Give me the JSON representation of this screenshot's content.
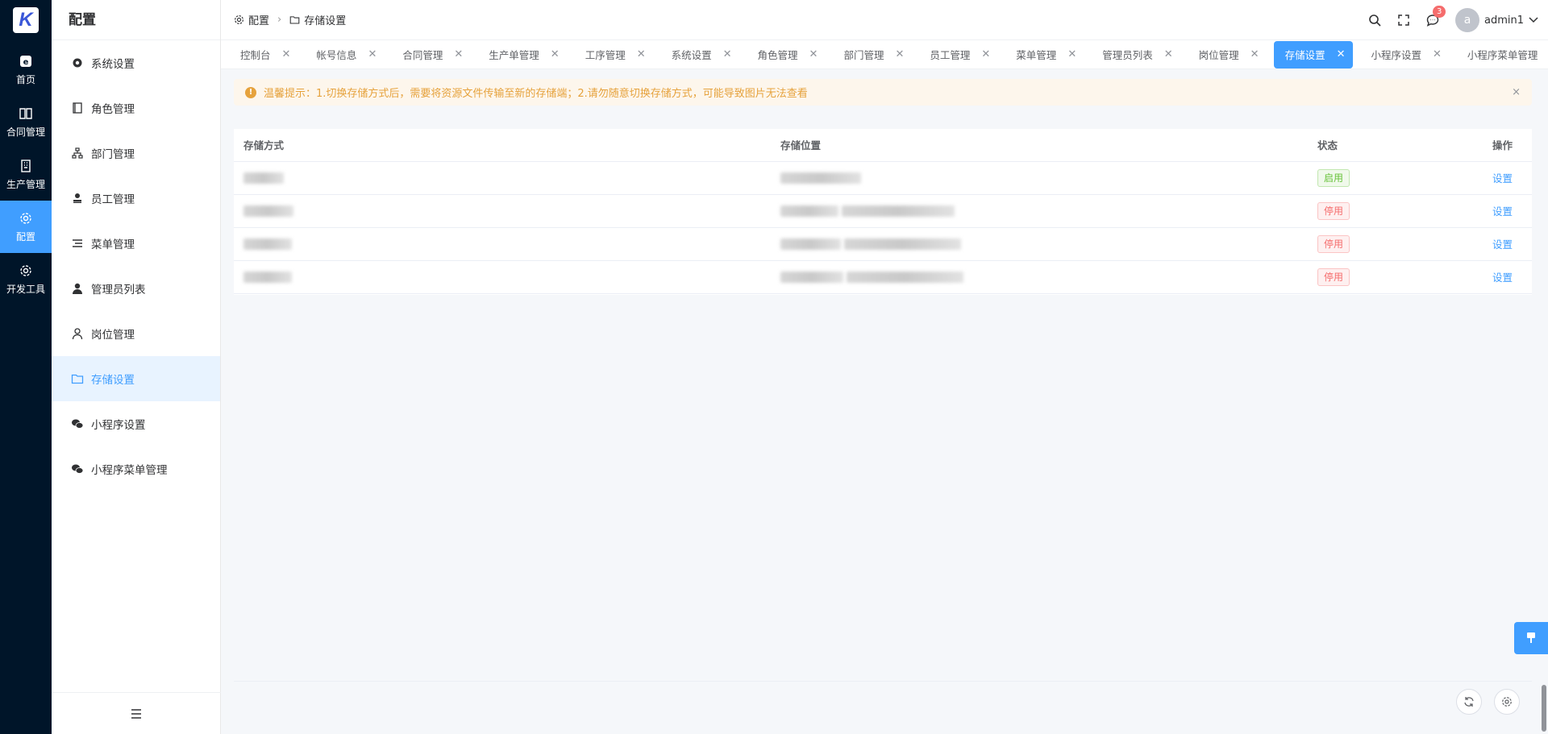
{
  "rail": {
    "logo_letter": "K",
    "items": [
      {
        "label": "首页",
        "icon": "home-icon"
      },
      {
        "label": "合同管理",
        "icon": "book-icon"
      },
      {
        "label": "生产管理",
        "icon": "building-icon"
      },
      {
        "label": "配置",
        "icon": "gear-icon",
        "active": true
      },
      {
        "label": "开发工具",
        "icon": "gear-icon"
      }
    ]
  },
  "sidebar": {
    "title": "配置",
    "items": [
      {
        "label": "系统设置",
        "icon": "gear-icon"
      },
      {
        "label": "角色管理",
        "icon": "notebook-icon"
      },
      {
        "label": "部门管理",
        "icon": "org-chart-icon"
      },
      {
        "label": "员工管理",
        "icon": "stamp-icon"
      },
      {
        "label": "菜单管理",
        "icon": "list-icon"
      },
      {
        "label": "管理员列表",
        "icon": "user-filled-icon"
      },
      {
        "label": "岗位管理",
        "icon": "user-outline-icon"
      },
      {
        "label": "存储设置",
        "icon": "folder-icon",
        "active": true
      },
      {
        "label": "小程序设置",
        "icon": "wechat-icon"
      },
      {
        "label": "小程序菜单管理",
        "icon": "wechat-icon"
      }
    ]
  },
  "header": {
    "breadcrumb": [
      "配置",
      "存储设置"
    ],
    "notification_count": "3",
    "avatar_letter": "a",
    "username": "admin1"
  },
  "tabs": [
    {
      "label": "控制台"
    },
    {
      "label": "帐号信息"
    },
    {
      "label": "合同管理"
    },
    {
      "label": "生产单管理"
    },
    {
      "label": "工序管理"
    },
    {
      "label": "系统设置"
    },
    {
      "label": "角色管理"
    },
    {
      "label": "部门管理"
    },
    {
      "label": "员工管理"
    },
    {
      "label": "菜单管理"
    },
    {
      "label": "管理员列表"
    },
    {
      "label": "岗位管理"
    },
    {
      "label": "存储设置",
      "active": true
    },
    {
      "label": "小程序设置"
    },
    {
      "label": "小程序菜单管理"
    }
  ],
  "alert": {
    "text": "温馨提示：1.切换存储方式后，需要将资源文件传输至新的存储端；2.请勿随意切换存储方式，可能导致图片无法查看",
    "close": "×"
  },
  "table": {
    "columns": [
      "存储方式",
      "存储位置",
      "状态",
      "操作"
    ],
    "rows": [
      {
        "status": "启用",
        "status_type": "on",
        "action": "设置"
      },
      {
        "status": "停用",
        "status_type": "off",
        "action": "设置"
      },
      {
        "status": "停用",
        "status_type": "off",
        "action": "设置"
      },
      {
        "status": "停用",
        "status_type": "off",
        "action": "设置"
      }
    ]
  },
  "colors": {
    "primary": "#409eff",
    "rail_bg": "#001529",
    "warning": "#e6a23c",
    "success": "#67c23a",
    "danger": "#f56c6c"
  }
}
